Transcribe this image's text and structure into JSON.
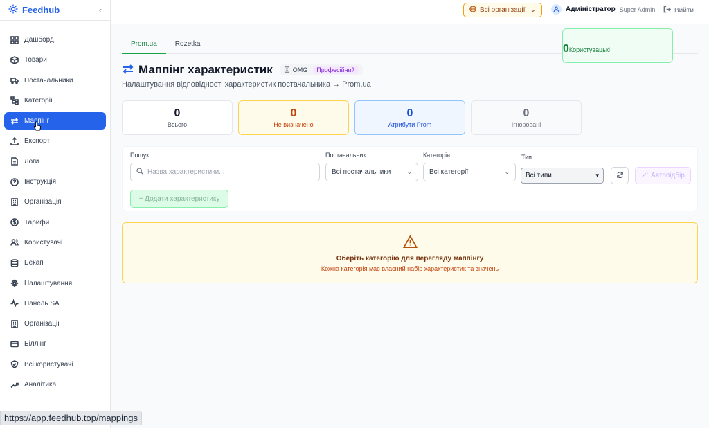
{
  "brand": {
    "name": "Feedhub"
  },
  "sidebar": {
    "items": [
      {
        "label": "Дашборд",
        "icon": "grid-icon"
      },
      {
        "label": "Товари",
        "icon": "box-icon"
      },
      {
        "label": "Постачальники",
        "icon": "truck-icon"
      },
      {
        "label": "Категорії",
        "icon": "category-tree-icon"
      },
      {
        "label": "Маппінг",
        "icon": "arrows-swap-icon",
        "active": true
      },
      {
        "label": "Експорт",
        "icon": "upload-icon"
      },
      {
        "label": "Логи",
        "icon": "file-text-icon"
      },
      {
        "label": "Інструкція",
        "icon": "help-circle-icon"
      },
      {
        "label": "Організація",
        "icon": "building-icon"
      },
      {
        "label": "Тарифи",
        "icon": "dollar-circle-icon"
      },
      {
        "label": "Користувачі",
        "icon": "users-icon"
      },
      {
        "label": "Бекап",
        "icon": "database-icon"
      },
      {
        "label": "Налаштування",
        "icon": "gear-icon"
      },
      {
        "label": "Панель SA",
        "icon": "activity-icon"
      },
      {
        "label": "Організації",
        "icon": "building-icon"
      },
      {
        "label": "Біллінг",
        "icon": "credit-card-icon"
      },
      {
        "label": "Всі користувачі",
        "icon": "shield-check-icon"
      },
      {
        "label": "Аналітика",
        "icon": "trending-up-icon"
      }
    ]
  },
  "topbar": {
    "org_select": "Всі організації",
    "user_name": "Адміністратор",
    "user_role": "Super Admin",
    "logout": "Вийти"
  },
  "tabs": [
    {
      "label": "Prom.ua",
      "active": true
    },
    {
      "label": "Rozetka",
      "active": false
    }
  ],
  "header": {
    "title": "Маппінг характеристик",
    "org_badge": "OMG",
    "plan_badge": "Професійний",
    "subtitle": "Налаштування відповідності характеристик постачальника → Prom.ua"
  },
  "stats": [
    {
      "value": "0",
      "label": "Всього"
    },
    {
      "value": "0",
      "label": "Не визначено"
    },
    {
      "value": "0",
      "label": "Атрибути Prom"
    },
    {
      "value": "0",
      "label": "Користувацькі"
    },
    {
      "value": "0",
      "label": "Ігноровані"
    }
  ],
  "filters": {
    "search_label": "Пошук",
    "search_placeholder": "Назва характеристики...",
    "supplier_label": "Постачальник",
    "supplier_value": "Всі постачальники",
    "category_label": "Категорія",
    "category_value": "Всі категорії",
    "type_label": "Тип",
    "type_value": "Всі типи",
    "auto_label": "Автопідбір",
    "add_label": "+ Додати характеристику"
  },
  "notice": {
    "title": "Оберіть категорію для перегляду маппінгу",
    "subtitle": "Кожна категорія має власний набір характеристик та значень"
  },
  "status_url": "https://app.feedhub.top/mappings",
  "colors": {
    "accent": "#2563eb",
    "success": "#16a34a",
    "warning": "#f59e0b"
  }
}
